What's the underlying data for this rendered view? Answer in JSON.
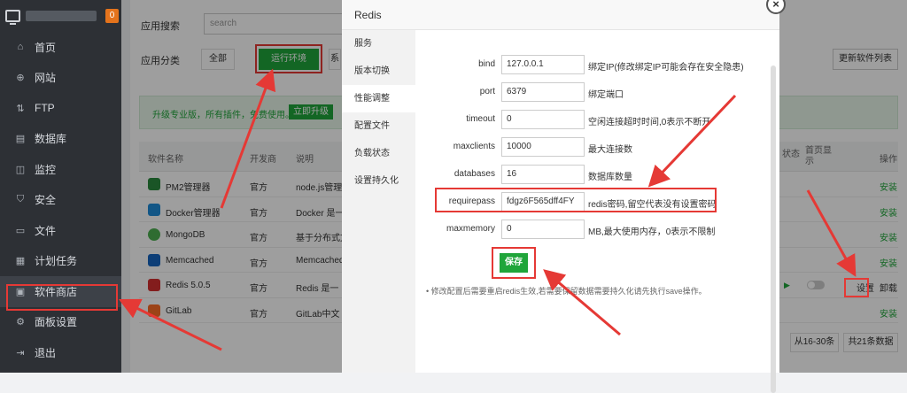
{
  "sidebar": {
    "badge": "0",
    "items": [
      {
        "label": "首页",
        "icon": "⌂"
      },
      {
        "label": "网站",
        "icon": "⊕"
      },
      {
        "label": "FTP",
        "icon": "⇅"
      },
      {
        "label": "数据库",
        "icon": "▤"
      },
      {
        "label": "监控",
        "icon": "◫"
      },
      {
        "label": "安全",
        "icon": "⛉"
      },
      {
        "label": "文件",
        "icon": "▭"
      },
      {
        "label": "计划任务",
        "icon": "▦"
      },
      {
        "label": "软件商店",
        "icon": "▣"
      },
      {
        "label": "面板设置",
        "icon": "⚙"
      },
      {
        "label": "退出",
        "icon": "⇥"
      }
    ]
  },
  "main": {
    "search_label": "应用搜索",
    "search_placeholder": "search",
    "category_label": "应用分类",
    "categories": [
      "全部",
      "运行环境",
      "系"
    ],
    "update_button": "更新软件列表",
    "promo_text": "升级专业版，所有插件，免费使用。",
    "promo_button": "立即升级",
    "columns": [
      "软件名称",
      "开发商",
      "说明",
      "状态",
      "首页显示",
      "操作"
    ],
    "rows": [
      {
        "name": "PM2管理器",
        "dev": "官方",
        "desc": "node.js管理",
        "action": "安装",
        "icon_color": "#2b8a3e"
      },
      {
        "name": "Docker管理器",
        "dev": "官方",
        "desc": "Docker 是一",
        "action": "安装",
        "icon_color": "#1d8cd8"
      },
      {
        "name": "MongoDB",
        "dev": "官方",
        "desc": "基于分布式文",
        "action": "安装",
        "icon_color": "#4caf50"
      },
      {
        "name": "Memcached",
        "dev": "官方",
        "desc": "Memcached",
        "action": "安装",
        "icon_color": "#1565c0"
      },
      {
        "name": "Redis 5.0.5",
        "dev": "官方",
        "desc": "Redis 是一",
        "action": "卸载",
        "setting": "设置",
        "icon_color": "#d32f2f"
      },
      {
        "name": "GitLab",
        "dev": "官方",
        "desc": "GitLab中文",
        "action": "安装",
        "icon_color": "#fc6d26"
      }
    ],
    "pager": [
      "从16-30条",
      "共21条数据"
    ]
  },
  "modal": {
    "title": "Redis",
    "close": "×",
    "nav": [
      "服务",
      "版本切换",
      "性能调整",
      "配置文件",
      "负载状态",
      "设置持久化"
    ],
    "fields": [
      {
        "label": "bind",
        "value": "127.0.0.1",
        "hint": "绑定IP(修改绑定IP可能会存在安全隐患)"
      },
      {
        "label": "port",
        "value": "6379",
        "hint": "绑定端口"
      },
      {
        "label": "timeout",
        "value": "0",
        "hint": "空闲连接超时时间,0表示不断开"
      },
      {
        "label": "maxclients",
        "value": "10000",
        "hint": "最大连接数"
      },
      {
        "label": "databases",
        "value": "16",
        "hint": "数据库数量"
      },
      {
        "label": "requirepass",
        "value": "fdgz6F565dff4FY",
        "hint": "redis密码,留空代表没有设置密码"
      },
      {
        "label": "maxmemory",
        "value": "0",
        "hint": "MB,最大使用内存，0表示不限制"
      }
    ],
    "save_button": "保存",
    "note": "•  修改配置后需要重启redis生效,若需要保留数据需要持久化请先执行save操作。"
  },
  "colors": {
    "accent": "#20a53a",
    "annotation": "#e53935",
    "sidebar_bg": "#2d3035"
  }
}
